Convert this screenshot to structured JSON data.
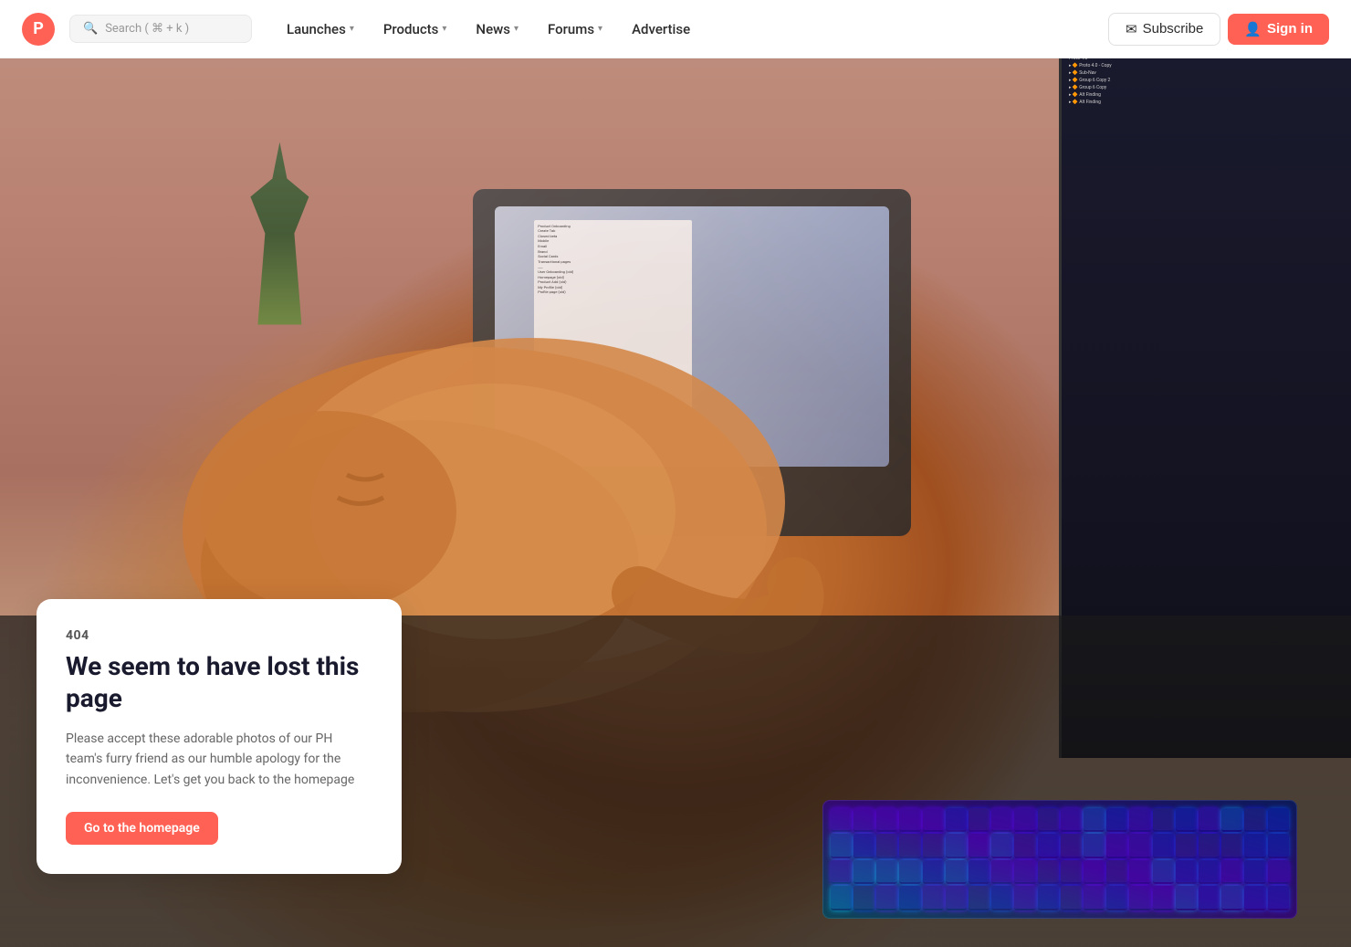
{
  "navbar": {
    "logo_letter": "P",
    "search_placeholder": "Search ( ⌘ + k )",
    "nav_items": [
      {
        "label": "Launches",
        "has_dropdown": true
      },
      {
        "label": "Products",
        "has_dropdown": true
      },
      {
        "label": "News",
        "has_dropdown": true
      },
      {
        "label": "Forums",
        "has_dropdown": true
      },
      {
        "label": "Advertise",
        "has_dropdown": false
      }
    ],
    "subscribe_label": "Subscribe",
    "signin_label": "Sign in"
  },
  "hero": {
    "alt_text": "A sleeping orange tabby cat on a desk with a laptop and keyboard"
  },
  "error_card": {
    "code": "404",
    "title": "We seem to have lost this page",
    "description": "Please accept these adorable photos of our PH team's furry friend as our humble apology for the inconvenience. Let's get you back to the homepage",
    "cta_label": "Go to the homepage"
  },
  "colors": {
    "accent": "#ff6154",
    "text_dark": "#1a1a2e",
    "text_medium": "#555",
    "text_light": "#666"
  }
}
